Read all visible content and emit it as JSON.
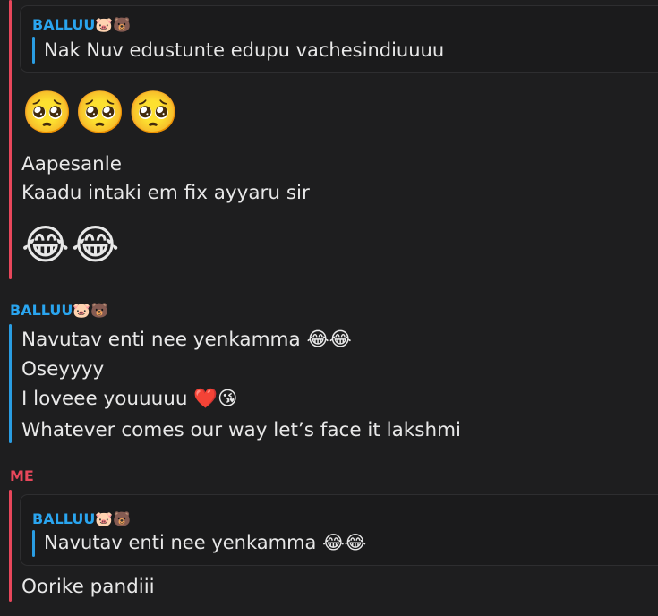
{
  "conversation": {
    "block1": {
      "quote": {
        "author": "BALLUU🐷🐻",
        "text": "Nak Nuv edustunte edupu vachesindiuuuu"
      },
      "emoji_line_1": "🥺🥺🥺",
      "lines": [
        "Aapesanle",
        "Kaadu intaki em fix ayyaru sir"
      ],
      "emoji_line_2": "😂😂"
    },
    "block2": {
      "sender": "BALLUU🐷🐻",
      "lines": [
        "Navutav enti nee yenkamma 😂😂",
        "Oseyyyy",
        "I loveee youuuuu ❤️😘",
        "Whatever comes our way let’s face it lakshmi"
      ]
    },
    "block3": {
      "sender": "ME",
      "quote": {
        "author": "BALLUU🐷🐻",
        "text": "Navutav enti nee yenkamma 😂😂"
      },
      "lines": [
        "Oorike pandiii"
      ]
    }
  },
  "colors": {
    "background": "#1e1e1f",
    "me_accent": "#e8475b",
    "friend_accent": "#2aa5ef"
  }
}
